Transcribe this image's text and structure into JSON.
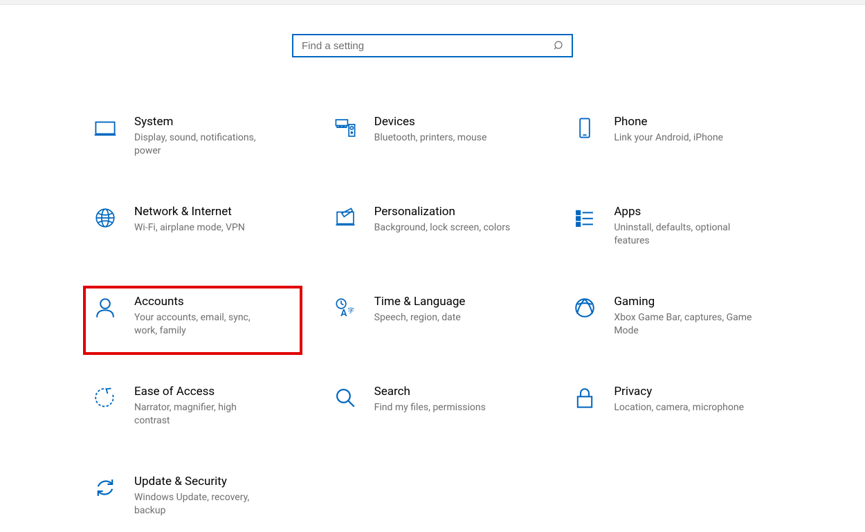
{
  "search": {
    "placeholder": "Find a setting"
  },
  "tiles": [
    {
      "title": "System",
      "desc": "Display, sound, notifications, power"
    },
    {
      "title": "Devices",
      "desc": "Bluetooth, printers, mouse"
    },
    {
      "title": "Phone",
      "desc": "Link your Android, iPhone"
    },
    {
      "title": "Network & Internet",
      "desc": "Wi-Fi, airplane mode, VPN"
    },
    {
      "title": "Personalization",
      "desc": "Background, lock screen, colors"
    },
    {
      "title": "Apps",
      "desc": "Uninstall, defaults, optional features"
    },
    {
      "title": "Accounts",
      "desc": "Your accounts, email, sync, work, family"
    },
    {
      "title": "Time & Language",
      "desc": "Speech, region, date"
    },
    {
      "title": "Gaming",
      "desc": "Xbox Game Bar, captures, Game Mode"
    },
    {
      "title": "Ease of Access",
      "desc": "Narrator, magnifier, high contrast"
    },
    {
      "title": "Search",
      "desc": "Find my files, permissions"
    },
    {
      "title": "Privacy",
      "desc": "Location, camera, microphone"
    },
    {
      "title": "Update & Security",
      "desc": "Windows Update, recovery, backup"
    }
  ]
}
